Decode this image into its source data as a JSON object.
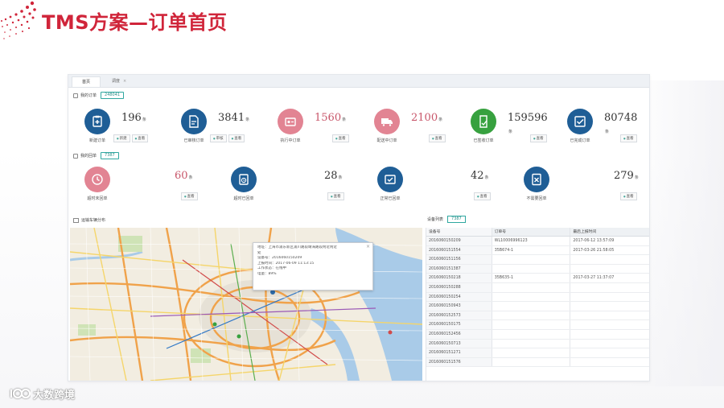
{
  "slide": {
    "title": "TMS方案—订单首页",
    "accent": "#d0253a"
  },
  "tabs": [
    {
      "label": "首页",
      "active": true
    },
    {
      "label": "调度",
      "active": false
    }
  ],
  "orders": {
    "heading": "我的订单",
    "count": "248041",
    "items": [
      {
        "label": "新建订单",
        "value": "196",
        "unit": "条",
        "icon": "clipboard-plus-icon",
        "color": "#1f5e96",
        "buttons": [
          "新建",
          "查看"
        ]
      },
      {
        "label": "已审核订单",
        "value": "3841",
        "unit": "条",
        "icon": "document-check-icon",
        "color": "#1f5e96",
        "buttons": [
          "审核",
          "查看"
        ]
      },
      {
        "label": "执行中订单",
        "value": "1560",
        "unit": "条",
        "icon": "progress-icon",
        "color": "#e28493",
        "buttons": [
          "查看"
        ]
      },
      {
        "label": "配送中订单",
        "value": "2100",
        "unit": "条",
        "icon": "truck-icon",
        "color": "#e28493",
        "buttons": [
          "查看"
        ]
      },
      {
        "label": "已签收订单",
        "value": "159596",
        "unit": "条",
        "icon": "signed-document-icon",
        "color": "#37a13f",
        "buttons": [
          "查看"
        ]
      },
      {
        "label": "已完成订单",
        "value": "80748",
        "unit": "条",
        "icon": "checkbox-icon",
        "color": "#1f5e96",
        "buttons": [
          "查看"
        ]
      }
    ]
  },
  "receipts": {
    "heading": "我的回单",
    "count": "7387",
    "items": [
      {
        "label": "超时未回单",
        "value": "60",
        "unit": "条",
        "icon": "clock-icon",
        "color": "#e28493",
        "buttons": [
          "查看"
        ]
      },
      {
        "label": "超时已回单",
        "value": "28",
        "unit": "条",
        "icon": "clipboard-clock-icon",
        "color": "#1f5e96",
        "buttons": [
          "查看"
        ]
      },
      {
        "label": "正常已回单",
        "value": "42",
        "unit": "条",
        "icon": "mail-check-icon",
        "color": "#1f5e96",
        "buttons": [
          "查看"
        ]
      },
      {
        "label": "不需要回单",
        "value": "279",
        "unit": "条",
        "icon": "document-x-icon",
        "color": "#1f5e96",
        "buttons": [
          "查看"
        ]
      }
    ]
  },
  "map": {
    "heading": "运输车辆分布",
    "popup": {
      "address": "地址：上海市浦东新区浦川路段靖海路段附近附近",
      "address2": "处",
      "device": "设备号：2016060150209",
      "time": "上报时间：2017-06-09 11:13:15",
      "status": "工作状态：在线中",
      "battery": "电量：89%"
    }
  },
  "devices": {
    "heading": "设备列表",
    "count": "7387",
    "columns": [
      "设备号",
      "订单号",
      "最后上报时间"
    ],
    "rows": [
      [
        "2016060150209",
        "WL10006996123",
        "2017-06-12 13:57:09"
      ],
      [
        "2016060151554",
        "35B674-1",
        "2017-03-26 21:58:05"
      ],
      [
        "2016060151156",
        "",
        ""
      ],
      [
        "2016060151387",
        "",
        ""
      ],
      [
        "2016060150218",
        "35B635-1",
        "2017-03-27 11:37:07"
      ],
      [
        "2016060150288",
        "",
        ""
      ],
      [
        "2016060150254",
        "",
        ""
      ],
      [
        "2016060150943",
        "",
        ""
      ],
      [
        "2016060152573",
        "",
        ""
      ],
      [
        "2016060150175",
        "",
        ""
      ],
      [
        "2016060152456",
        "",
        ""
      ],
      [
        "2016060150713",
        "",
        ""
      ],
      [
        "2016060151271",
        "",
        ""
      ],
      [
        "2016060151576",
        "",
        ""
      ]
    ]
  },
  "watermark": {
    "text": "大数跨境"
  }
}
